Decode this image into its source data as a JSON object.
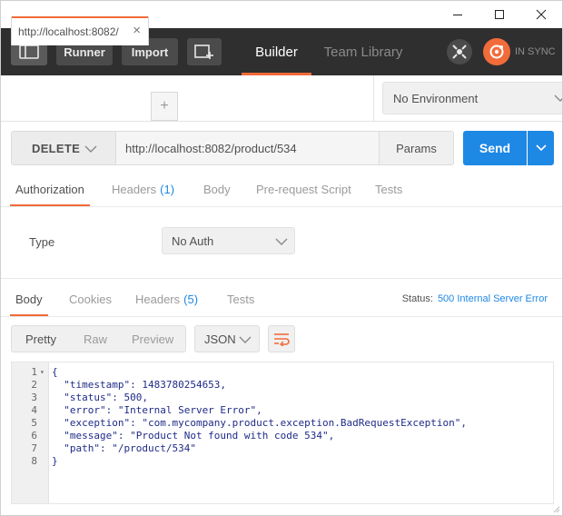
{
  "window": {
    "controls": [
      "minimize-icon",
      "maximize-icon",
      "close-icon"
    ]
  },
  "toolbar": {
    "runner_label": "Runner",
    "import_label": "Import",
    "builder_label": "Builder",
    "team_library_label": "Team Library",
    "sync_label": "IN SYNC",
    "accent": "#f26b3a"
  },
  "request_tab": {
    "label": "http://localhost:8082/",
    "close_glyph": "×",
    "add_glyph": "+"
  },
  "environment": {
    "selected": "No Environment"
  },
  "request": {
    "method": "DELETE",
    "url": "http://localhost:8082/product/534",
    "params_label": "Params",
    "send_label": "Send",
    "send_color": "#1e88e5"
  },
  "request_tabs": [
    {
      "label": "Authorization",
      "count": ""
    },
    {
      "label": "Headers",
      "count": "(1)"
    },
    {
      "label": "Body",
      "count": ""
    },
    {
      "label": "Pre-request Script",
      "count": ""
    },
    {
      "label": "Tests",
      "count": ""
    }
  ],
  "auth": {
    "type_label": "Type",
    "type_value": "No Auth"
  },
  "response_tabs": [
    {
      "label": "Body",
      "count": ""
    },
    {
      "label": "Cookies",
      "count": ""
    },
    {
      "label": "Headers",
      "count": "(5)"
    },
    {
      "label": "Tests",
      "count": ""
    }
  ],
  "response_status": {
    "label": "Status:",
    "value": "500 Internal Server Error"
  },
  "body_format": {
    "modes": [
      "Pretty",
      "Raw",
      "Preview"
    ],
    "language": "JSON"
  },
  "response_body": {
    "lines": [
      {
        "num": "1",
        "fold": "▾",
        "text": "{"
      },
      {
        "num": "2",
        "fold": "",
        "text": "  \"timestamp\": 1483780254653,"
      },
      {
        "num": "3",
        "fold": "",
        "text": "  \"status\": 500,"
      },
      {
        "num": "4",
        "fold": "",
        "text": "  \"error\": \"Internal Server Error\","
      },
      {
        "num": "5",
        "fold": "",
        "text": "  \"exception\": \"com.mycompany.product.exception.BadRequestException\","
      },
      {
        "num": "6",
        "fold": "",
        "text": "  \"message\": \"Product Not found with code 534\","
      },
      {
        "num": "7",
        "fold": "",
        "text": "  \"path\": \"/product/534\""
      },
      {
        "num": "8",
        "fold": "",
        "text": "}"
      }
    ]
  }
}
